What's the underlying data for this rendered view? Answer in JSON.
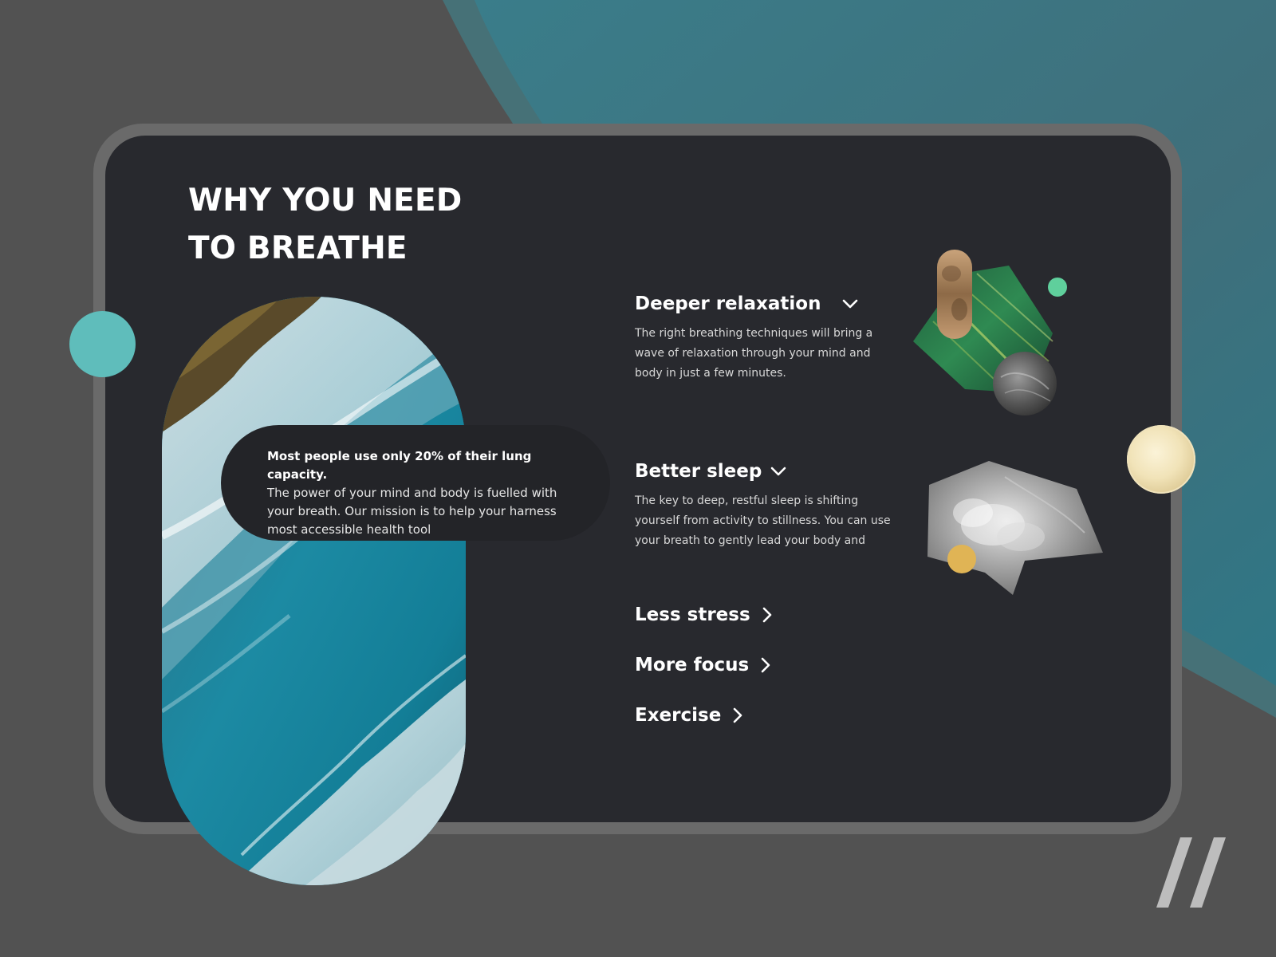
{
  "title": {
    "line1": "WHY YOU NEED",
    "line2": "TO BREATHE"
  },
  "stat_card": {
    "lead": "Most people use only 20% of their lung capacity.",
    "body": "The power of your mind and body is fuelled with your breath. Our mission is to help your harness most accessible health tool"
  },
  "features": [
    {
      "label": "Deeper relaxation",
      "icon": "chevron-down-icon",
      "expanded": true,
      "body": "The right breathing techniques will bring a wave of relaxation through your mind and body in just a few minutes."
    },
    {
      "label": "Better sleep",
      "icon": "chevron-down-icon",
      "expanded": true,
      "body": "The key to deep, restful sleep is shifting yourself from activity to stillness. You can use your breath to gently lead your body and"
    },
    {
      "label": "Less stress",
      "icon": "chevron-right-icon",
      "expanded": false
    },
    {
      "label": "More focus",
      "icon": "chevron-right-icon",
      "expanded": false
    },
    {
      "label": "Exercise",
      "icon": "chevron-right-icon",
      "expanded": false
    }
  ],
  "colors": {
    "background": "#525252",
    "device_frame": "#6a6a6a",
    "screen": "#28292e",
    "teal_accent": "#5fbdbb",
    "mint_dot": "#5fcf9c",
    "gold_dot": "#e0b455"
  }
}
